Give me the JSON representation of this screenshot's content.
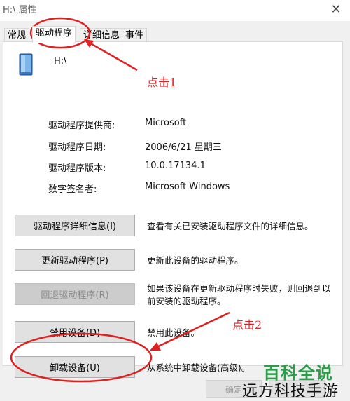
{
  "window": {
    "title": "H:\\ 属性",
    "close_glyph": "✕"
  },
  "tabs": [
    {
      "label": "常规"
    },
    {
      "label": "驱动程序"
    },
    {
      "label": "详细信息"
    },
    {
      "label": "事件"
    }
  ],
  "device": {
    "name": "H:\\",
    "icon": "drive-icon"
  },
  "properties": [
    {
      "label": "驱动程序提供商:",
      "value": "Microsoft"
    },
    {
      "label": "驱动程序日期:",
      "value": "2006/6/21 星期三"
    },
    {
      "label": "驱动程序版本:",
      "value": "10.0.17134.1"
    },
    {
      "label": "数字签名者:",
      "value": "Microsoft Windows"
    }
  ],
  "actions": [
    {
      "button": "驱动程序详细信息(I)",
      "description": "查看有关已安装驱动程序文件的详细信息。",
      "enabled": true
    },
    {
      "button": "更新驱动程序(P)",
      "description": "更新此设备的驱动程序。",
      "enabled": true
    },
    {
      "button": "回退驱动程序(R)",
      "description": "如果该设备在更新驱动程序时失败，则回退到以前安装的驱动程序。",
      "enabled": false
    },
    {
      "button": "禁用设备(D)",
      "description": "禁用此设备。",
      "enabled": true
    },
    {
      "button": "卸载设备(U)",
      "description": "从系统中卸载设备(高级)。",
      "enabled": true
    }
  ],
  "footer": {
    "ok_label": "确定"
  },
  "annotations": {
    "step1": "点击1",
    "step2": "点击2",
    "color": "#e02020"
  },
  "watermark": {
    "main": "百科全说",
    "sub": "远方科技手游",
    "color": "#2a9b49"
  }
}
